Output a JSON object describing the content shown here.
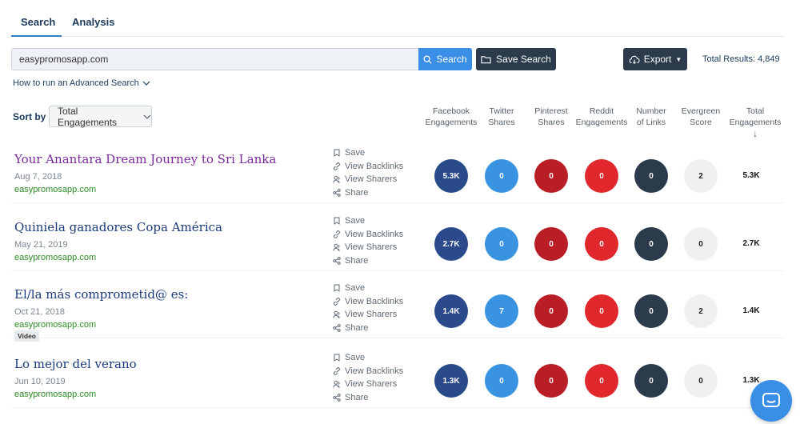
{
  "tabs": [
    {
      "label": "Search"
    },
    {
      "label": "Analysis"
    }
  ],
  "search": {
    "value": "easypromosapp.com",
    "button_label": "Search",
    "save_label": "Save Search",
    "export_label": "Export",
    "total_results": "Total Results: 4,849"
  },
  "advanced_link": "How to run an Advanced Search",
  "sort": {
    "label": "Sort by",
    "value": "Total Engagements"
  },
  "columns": [
    [
      "Facebook",
      "Engagements"
    ],
    [
      "Twitter",
      "Shares"
    ],
    [
      "Pinterest",
      "Shares"
    ],
    [
      "Reddit",
      "Engagements"
    ],
    [
      "Number",
      "of Links"
    ],
    [
      "Evergreen",
      "Score"
    ],
    [
      "Total",
      "Engagements"
    ]
  ],
  "sort_arrow": "↓",
  "actions": [
    "Save",
    "View Backlinks",
    "View Sharers",
    "Share"
  ],
  "colors": {
    "facebook": "#2b4a8c",
    "twitter": "#3a93e0",
    "pinterest": "#b91d25",
    "reddit": "#e0272c",
    "links": "#2b3b4c",
    "evergreen": "#eef0f2",
    "accent": "#3a8ee6"
  },
  "rows": [
    {
      "title": "Your Anantara Dream Journey to Sri Lanka",
      "date": "Aug 7, 2018",
      "domain": "easypromosapp.com",
      "badge": null,
      "visited": true,
      "facebook": "5.3K",
      "twitter": "0",
      "pinterest": "0",
      "reddit": "0",
      "links": "0",
      "evergreen": "2",
      "total": "5.3K"
    },
    {
      "title": "Quiniela ganadores Copa América",
      "date": "May 21, 2019",
      "domain": "easypromosapp.com",
      "badge": null,
      "visited": false,
      "facebook": "2.7K",
      "twitter": "0",
      "pinterest": "0",
      "reddit": "0",
      "links": "0",
      "evergreen": "0",
      "total": "2.7K"
    },
    {
      "title": "El/la más comprometid@ es:",
      "date": "Oct 21, 2018",
      "domain": "easypromosapp.com",
      "badge": "Video",
      "visited": false,
      "facebook": "1.4K",
      "twitter": "7",
      "pinterest": "0",
      "reddit": "0",
      "links": "0",
      "evergreen": "2",
      "total": "1.4K"
    },
    {
      "title": "Lo mejor del verano",
      "date": "Jun 10, 2019",
      "domain": "easypromosapp.com",
      "badge": null,
      "visited": false,
      "facebook": "1.3K",
      "twitter": "0",
      "pinterest": "0",
      "reddit": "0",
      "links": "0",
      "evergreen": "0",
      "total": "1.3K"
    }
  ]
}
